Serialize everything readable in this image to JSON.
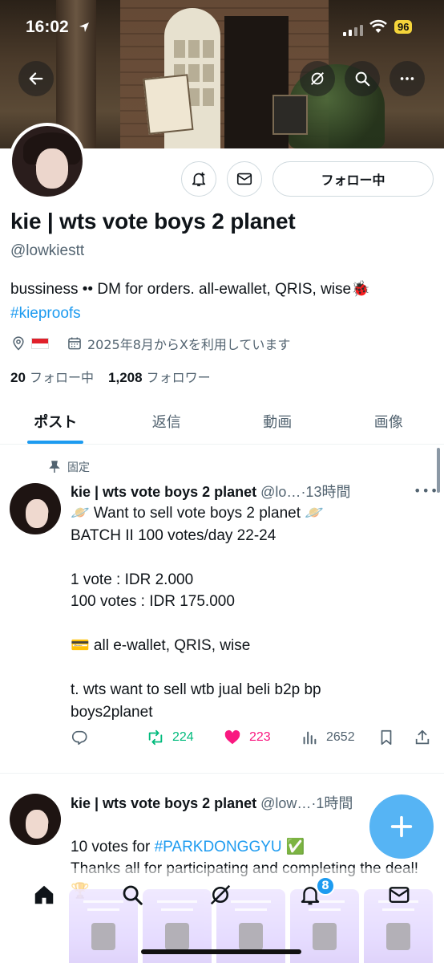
{
  "status_bar": {
    "time": "16:02",
    "battery": "96"
  },
  "profile": {
    "name": "kie | wts vote boys 2 planet",
    "handle": "@lowkiestt",
    "bio_text": "bussiness •• DM for orders. all-ewallet, QRIS, wise🐞",
    "bio_hashtag": "#kieproofs",
    "joined": "2025年8月からXを利用しています",
    "following_count": "20",
    "following_label": "フォロー中",
    "followers_count": "1,208",
    "followers_label": "フォロワー",
    "follow_button": "フォロー中"
  },
  "tabs": [
    "ポスト",
    "返信",
    "動画",
    "画像"
  ],
  "active_tab": "ポスト",
  "posts": [
    {
      "pinned_label": "固定",
      "author": "kie | wts vote boys 2 planet",
      "handle": "@lo…",
      "time": "·13時間",
      "body": "🪐 Want to sell vote boys 2 planet 🪐\nBATCH II 100 votes/day 22-24\n\n1 vote : IDR 2.000\n100 votes : IDR 175.000\n\n💳 all e-wallet, QRIS, wise\n\nt. wts want to sell wtb jual beli b2p bp\nboys2planet",
      "retweets": "224",
      "likes": "223",
      "views": "2652"
    },
    {
      "author": "kie | wts vote boys 2 planet",
      "handle": "@low…",
      "time": "·1時間",
      "body_prefix": "10 votes for ",
      "body_hashtag": "#PARKDONGGYU",
      "body_suffix": " ✅",
      "body_rest": "Thanks all for participating and completing the deal! 🏆"
    }
  ],
  "nav": {
    "notification_badge": "8"
  },
  "colors": {
    "accent": "#1d9bf0",
    "retweet": "#00ba7c",
    "like": "#f91880",
    "text": "#0f1419",
    "muted": "#536471"
  }
}
